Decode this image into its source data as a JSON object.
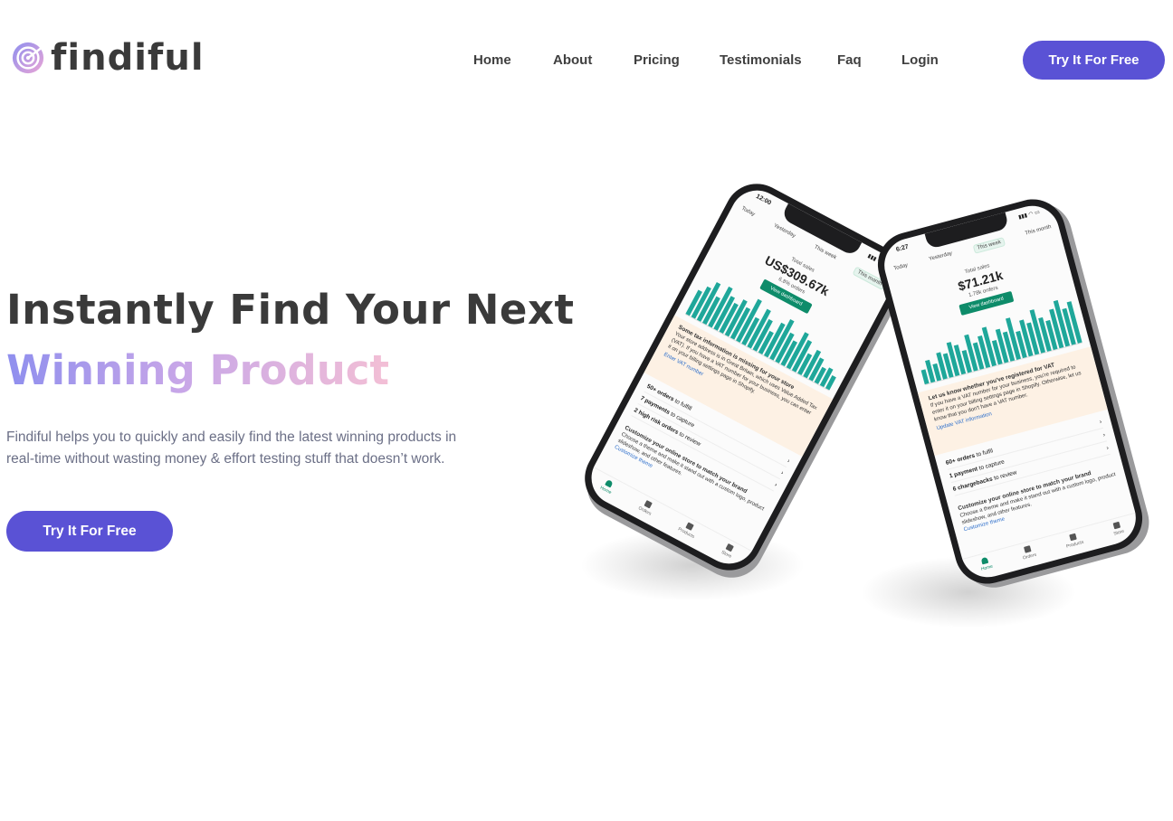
{
  "brand": {
    "name": "findiful",
    "accent": "#5a52d5",
    "logo_colors": [
      "#8f8fee",
      "#e9a5d6"
    ]
  },
  "nav": {
    "items": [
      {
        "label": "Home"
      },
      {
        "label": "About"
      },
      {
        "label": "Pricing"
      },
      {
        "label": "Testimonials"
      },
      {
        "label": "Faq"
      },
      {
        "label": "Login"
      }
    ],
    "cta_label": "Try It For Free"
  },
  "hero": {
    "title_line1": "Instantly Find Your Next",
    "title_line2": "Winning Product",
    "title_gradient": [
      "#8f8fee",
      "#c7a6e8",
      "#f3bfd5"
    ],
    "description": "Findiful helps you to quickly and easily find the latest winning products in real-time without wasting money & effort testing stuff that doesn’t work.",
    "cta_label": "Try It For Free"
  },
  "phones": [
    {
      "status_time": "12:00",
      "tabs": [
        "Today",
        "Yesterday",
        "This week",
        "This month"
      ],
      "active_tab": "This month",
      "kpi_label": "Total sales",
      "kpi_value": "US$309.67k",
      "kpi_sub": "6.8% orders",
      "kpi_button": "View dashboard",
      "bar_values": [
        0.55,
        0.7,
        0.85,
        0.6,
        0.9,
        0.75,
        0.65,
        0.8,
        0.7,
        0.95,
        0.6,
        0.85,
        0.7,
        0.5,
        0.75,
        0.9,
        0.65,
        0.55,
        0.8,
        0.7,
        0.45,
        0.6,
        0.5,
        0.35,
        0.4,
        0.3
      ],
      "notice_title": "Some tax information is missing for your store",
      "notice_body": "Your store address is in Great Britain, which uses Value Added Tax (VAT). If you have a VAT number for your business, you can enter it on your billing settings page in Shopify.",
      "notice_link": "Enter VAT number",
      "tasks": [
        {
          "bold": "50+ orders",
          "rest": " to fulfill"
        },
        {
          "bold": "7 payments",
          "rest": " to capture"
        },
        {
          "bold": "2 high risk orders",
          "rest": " to review"
        }
      ],
      "brand_title": "Customize your online store to match your brand",
      "brand_body": "Choose a theme and make it stand out with a custom logo, product slideshow, and other features.",
      "brand_link": "Customize theme",
      "bottom_nav": [
        "Home",
        "Orders",
        "Products",
        "Store"
      ]
    },
    {
      "status_time": "6:27",
      "tabs": [
        "Today",
        "Yesterday",
        "This week",
        "This month"
      ],
      "active_tab": "This week",
      "kpi_label": "Total sales",
      "kpi_value": "$71.21k",
      "kpi_sub": "1.78k orders",
      "kpi_button": "View dashboard",
      "bar_values": [
        0.3,
        0.45,
        0.35,
        0.55,
        0.5,
        0.7,
        0.6,
        0.45,
        0.75,
        0.55,
        0.65,
        0.8,
        0.5,
        0.7,
        0.6,
        0.85,
        0.55,
        0.75,
        0.65,
        0.9,
        0.7,
        0.6,
        0.8,
        0.95,
        0.75,
        0.85
      ],
      "notice_title": "Let us know whether you've registered for VAT",
      "notice_body": "If you have a VAT number for your business, you're required to enter it on your billing settings page in Shopify. Otherwise, let us know that you don't have a VAT number.",
      "notice_link": "Update VAT information",
      "tasks": [
        {
          "bold": "60+ orders",
          "rest": " to fulfil"
        },
        {
          "bold": "1 payment",
          "rest": " to capture"
        },
        {
          "bold": "6 chargebacks",
          "rest": " to review"
        }
      ],
      "brand_title": "Customize your online store to match your brand",
      "brand_body": "Choose a theme and make it stand out with a custom logo, product slideshow, and other features.",
      "brand_link": "Customize theme",
      "bottom_nav": [
        "Home",
        "Orders",
        "Products",
        "Store"
      ]
    }
  ]
}
